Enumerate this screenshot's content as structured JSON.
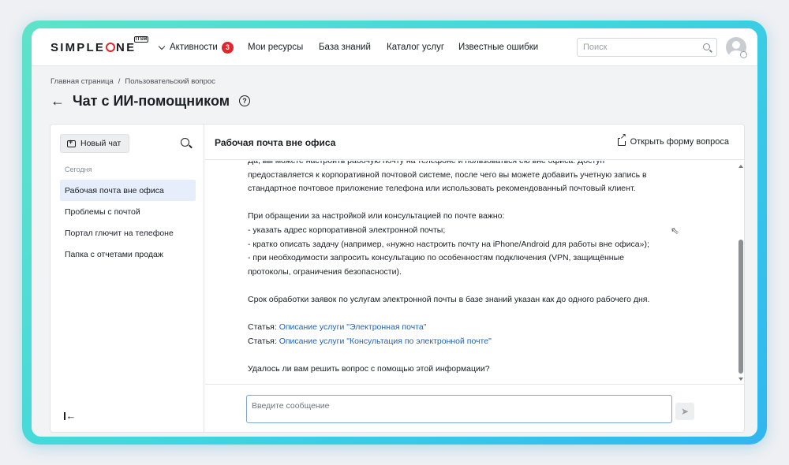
{
  "header": {
    "logo_text": "SIMPLEONE",
    "logo_badge": "ITSM",
    "nav": [
      {
        "label": "Активности",
        "badge": "3"
      },
      {
        "label": "Мои ресурсы"
      },
      {
        "label": "База знаний"
      },
      {
        "label": "Каталог услуг"
      },
      {
        "label": "Известные ошибки"
      }
    ],
    "search_placeholder": "Поиск"
  },
  "breadcrumb": [
    "Главная страница",
    "Пользовательский вопрос"
  ],
  "page_title": "Чат с ИИ-помощником",
  "sidebar": {
    "new_chat_label": "Новый чат",
    "group_label": "Сегодня",
    "chats": [
      {
        "label": "Рабочая почта вне офиса",
        "active": true
      },
      {
        "label": "Проблемы с почтой",
        "active": false
      },
      {
        "label": "Портал глючит на телефоне",
        "active": false
      },
      {
        "label": "Папка с отчетами продаж",
        "active": false
      }
    ]
  },
  "chat": {
    "title": "Рабочая почта вне офиса",
    "open_form_label": "Открыть форму вопроса",
    "lines": [
      "Да, вы можете настроить рабочую почту на телефоне и пользоваться ею вне офиса. Доступ",
      "предоставляется к корпоративной почтовой системе, после чего вы можете добавить учетную запись в",
      "стандартное почтовое приложение телефона или использовать рекомендованный почтовый клиент.",
      "",
      "При обращении за настройкой или консультацией по почте важно:",
      "- указать адрес корпоративной электронной почты;",
      "- кратко описать задачу (например, «нужно настроить почту на iPhone/Android для работы вне офиса»);",
      "- при необходимости запросить консультацию по особенностям подключения (VPN, защищённые",
      "протоколы, ограничения безопасности).",
      "",
      "Срок обработки заявок по услугам электронной почты в базе знаний указан как до одного рабочего дня.",
      ""
    ],
    "articles": [
      {
        "prefix": "Статья: ",
        "link": "Описание услуги \"Электронная почта\""
      },
      {
        "prefix": "Статья: ",
        "link": "Описание услуги \"Консультация по электронной почте\""
      }
    ],
    "closing_question": "Удалось ли вам решить вопрос с помощью этой информации?",
    "input_placeholder": "Введите сообщение"
  },
  "colors": {
    "accent_red": "#e3262c",
    "link_blue": "#1f63b8",
    "active_item_bg": "#e6eefb",
    "frame_gradient_start": "#5fe3c8",
    "frame_gradient_end": "#2fb6f0"
  },
  "icons": {
    "back": "arrow-left-icon",
    "help": "question-circle-icon",
    "new_chat": "chat-plus-icon",
    "search": "search-icon",
    "open_form": "external-link-icon",
    "collapse": "collapse-sidebar-icon",
    "send": "send-icon",
    "avatar": "user-avatar-icon"
  }
}
